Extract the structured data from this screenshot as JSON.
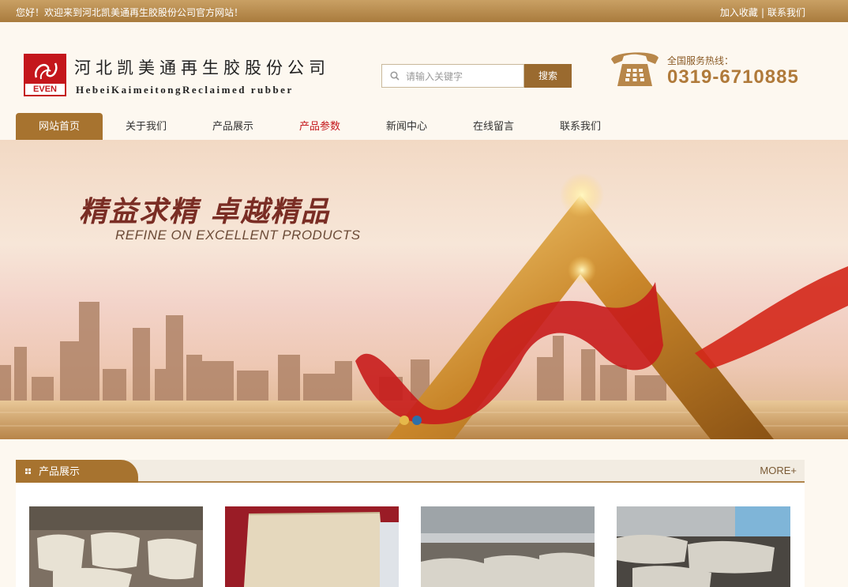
{
  "topbar": {
    "welcome": "您好！欢迎来到河北凯美通再生胶股份公司官方网站！",
    "bookmark": "加入收藏",
    "separator": "|",
    "contact": "联系我们"
  },
  "header": {
    "logo_text": "EVEN",
    "company_cn": "河北凯美通再生胶股份公司",
    "company_en": "HebeiKaimeitongReclaimed rubber",
    "search": {
      "placeholder": "请输入关键字",
      "button": "搜索"
    },
    "hotline_label": "全国服务热线：",
    "hotline_number": "0319-6710885"
  },
  "nav": {
    "items": [
      {
        "label": "网站首页",
        "active": true
      },
      {
        "label": "关于我们"
      },
      {
        "label": "产品展示"
      },
      {
        "label": "产品参数",
        "highlight": true
      },
      {
        "label": "新闻中心"
      },
      {
        "label": "在线留言"
      },
      {
        "label": "联系我们"
      }
    ]
  },
  "banner": {
    "slogan_cn": "精益求精 卓越精品",
    "slogan_en": "REFINE ON EXCELLENT PRODUCTS",
    "slides": 2,
    "active_slide": 2
  },
  "products": {
    "title": "产品展示",
    "more": "MORE+",
    "items": [
      {
        "image": "reclaimed-rubber-bales-photo"
      },
      {
        "image": "reclaimed-rubber-sheet-photo"
      },
      {
        "image": "warehouse-rubber-stack-photo"
      },
      {
        "image": "rubber-sheets-pile-photo"
      }
    ]
  },
  "colors": {
    "brand_brown": "#a7732f",
    "logo_red": "#c4161c",
    "highlight_red": "#c4161c"
  }
}
